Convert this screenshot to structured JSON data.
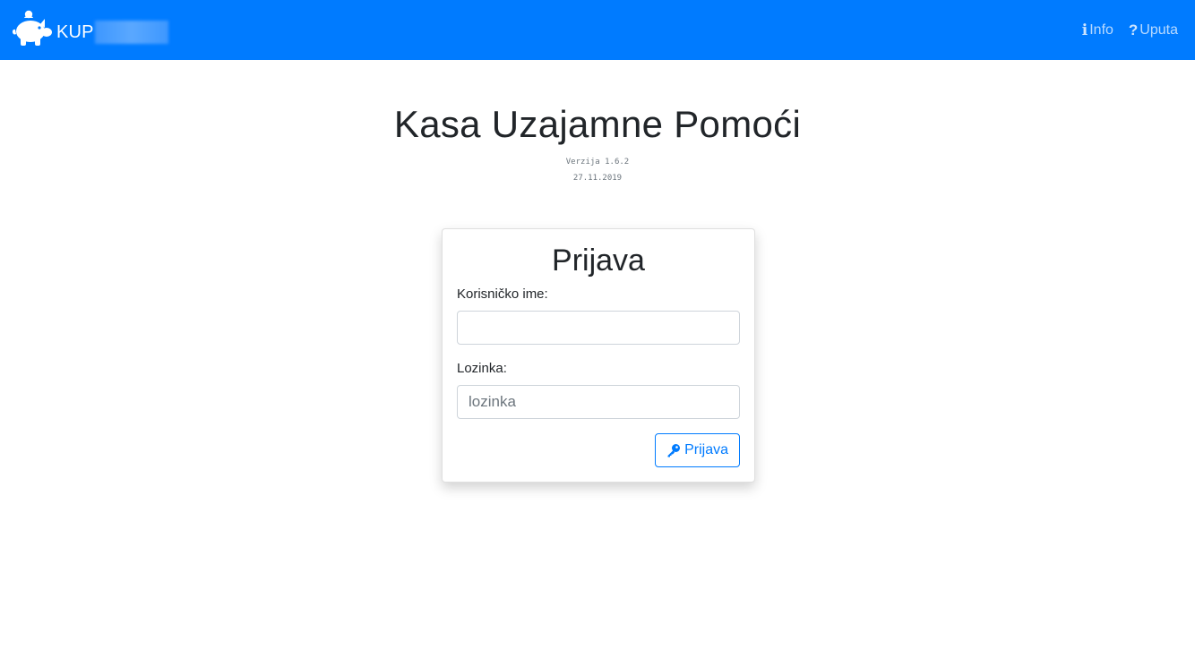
{
  "navbar": {
    "brand_text": "KUP",
    "brand_icon": "piggy-bank-icon",
    "links": [
      {
        "label": "Info",
        "icon": "info-icon",
        "glyph": "ℹ"
      },
      {
        "label": "Uputa",
        "icon": "question-icon",
        "glyph": "?"
      }
    ],
    "background": "#007bff"
  },
  "page": {
    "title": "Kasa Uzajamne Pomoći",
    "version": "Verzija 1.6.2",
    "date": "27.11.2019"
  },
  "login": {
    "title": "Prijava",
    "username_label": "Korisničko ime:",
    "username_value": "",
    "password_label": "Lozinka:",
    "password_placeholder": "lozinka",
    "submit_label": "Prijava",
    "submit_icon": "key-icon",
    "accent": "#007bff"
  }
}
